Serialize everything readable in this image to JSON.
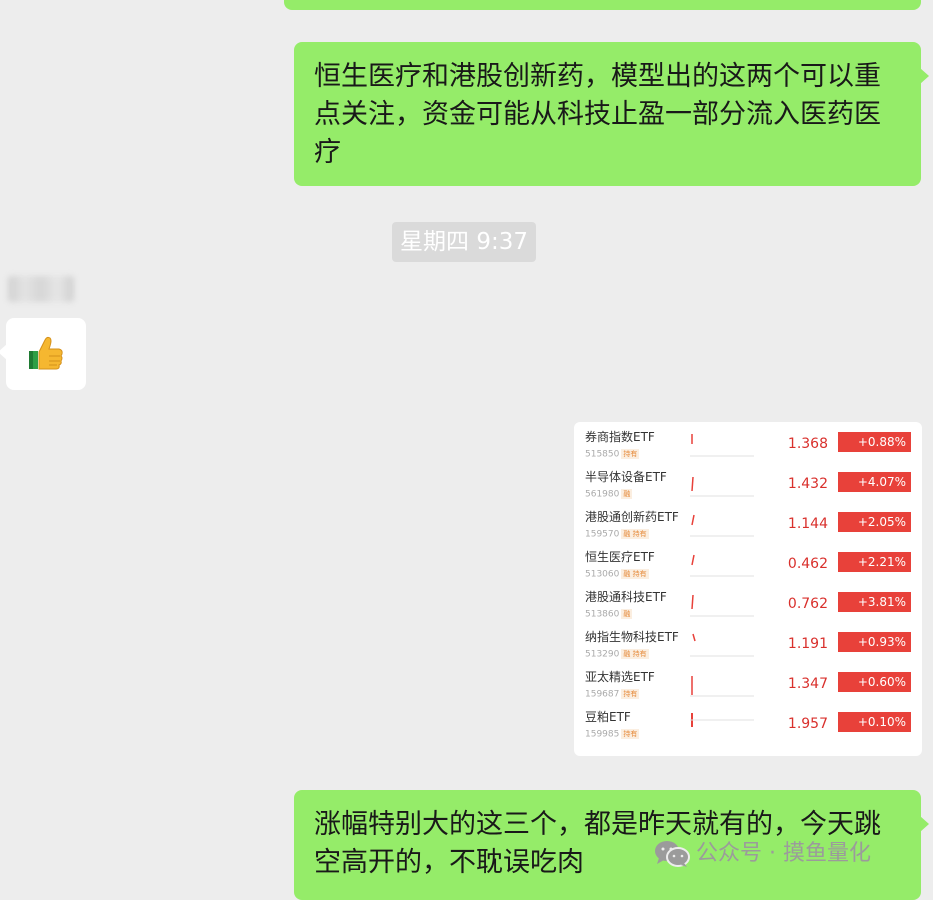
{
  "messages": {
    "msg1_lines": [
      "恒生医疗和港股创新药，模型出的这两个可以重",
      "点关注，资金可能从科技止盈一部分流入医药医",
      "疗"
    ],
    "timestamp": "星期四 9:37",
    "reaction_icon": "thumbs-up-icon",
    "msg2_lines": [
      "涨幅特别大的这三个，都是昨天就有的，今天跳",
      "空高开的，不耽误吃肉"
    ]
  },
  "etf_list": [
    {
      "name": "券商指数ETF",
      "code": "515850",
      "tag": "持有",
      "price": "1.368",
      "change": "+0.88%"
    },
    {
      "name": "半导体设备ETF",
      "code": "561980",
      "tag": "融",
      "price": "1.432",
      "change": "+4.07%"
    },
    {
      "name": "港股通创新药ETF",
      "code": "159570",
      "tag": "融 持有",
      "price": "1.144",
      "change": "+2.05%"
    },
    {
      "name": "恒生医疗ETF",
      "code": "513060",
      "tag": "融 持有",
      "price": "0.462",
      "change": "+2.21%"
    },
    {
      "name": "港股通科技ETF",
      "code": "513860",
      "tag": "融",
      "price": "0.762",
      "change": "+3.81%"
    },
    {
      "name": "纳指生物科技ETF",
      "code": "513290",
      "tag": "融 持有",
      "price": "1.191",
      "change": "+0.93%"
    },
    {
      "name": "亚太精选ETF",
      "code": "159687",
      "tag": "持有",
      "price": "1.347",
      "change": "+0.60%"
    },
    {
      "name": "豆粕ETF",
      "code": "159985",
      "tag": "持有",
      "price": "1.957",
      "change": "+0.10%"
    }
  ],
  "watermark": {
    "icon": "wechat-icon",
    "text": "公众号 · 摸鱼量化"
  },
  "colors": {
    "my_bubble": "#95ec69",
    "up_red": "#e8413a",
    "background": "#ededed"
  }
}
